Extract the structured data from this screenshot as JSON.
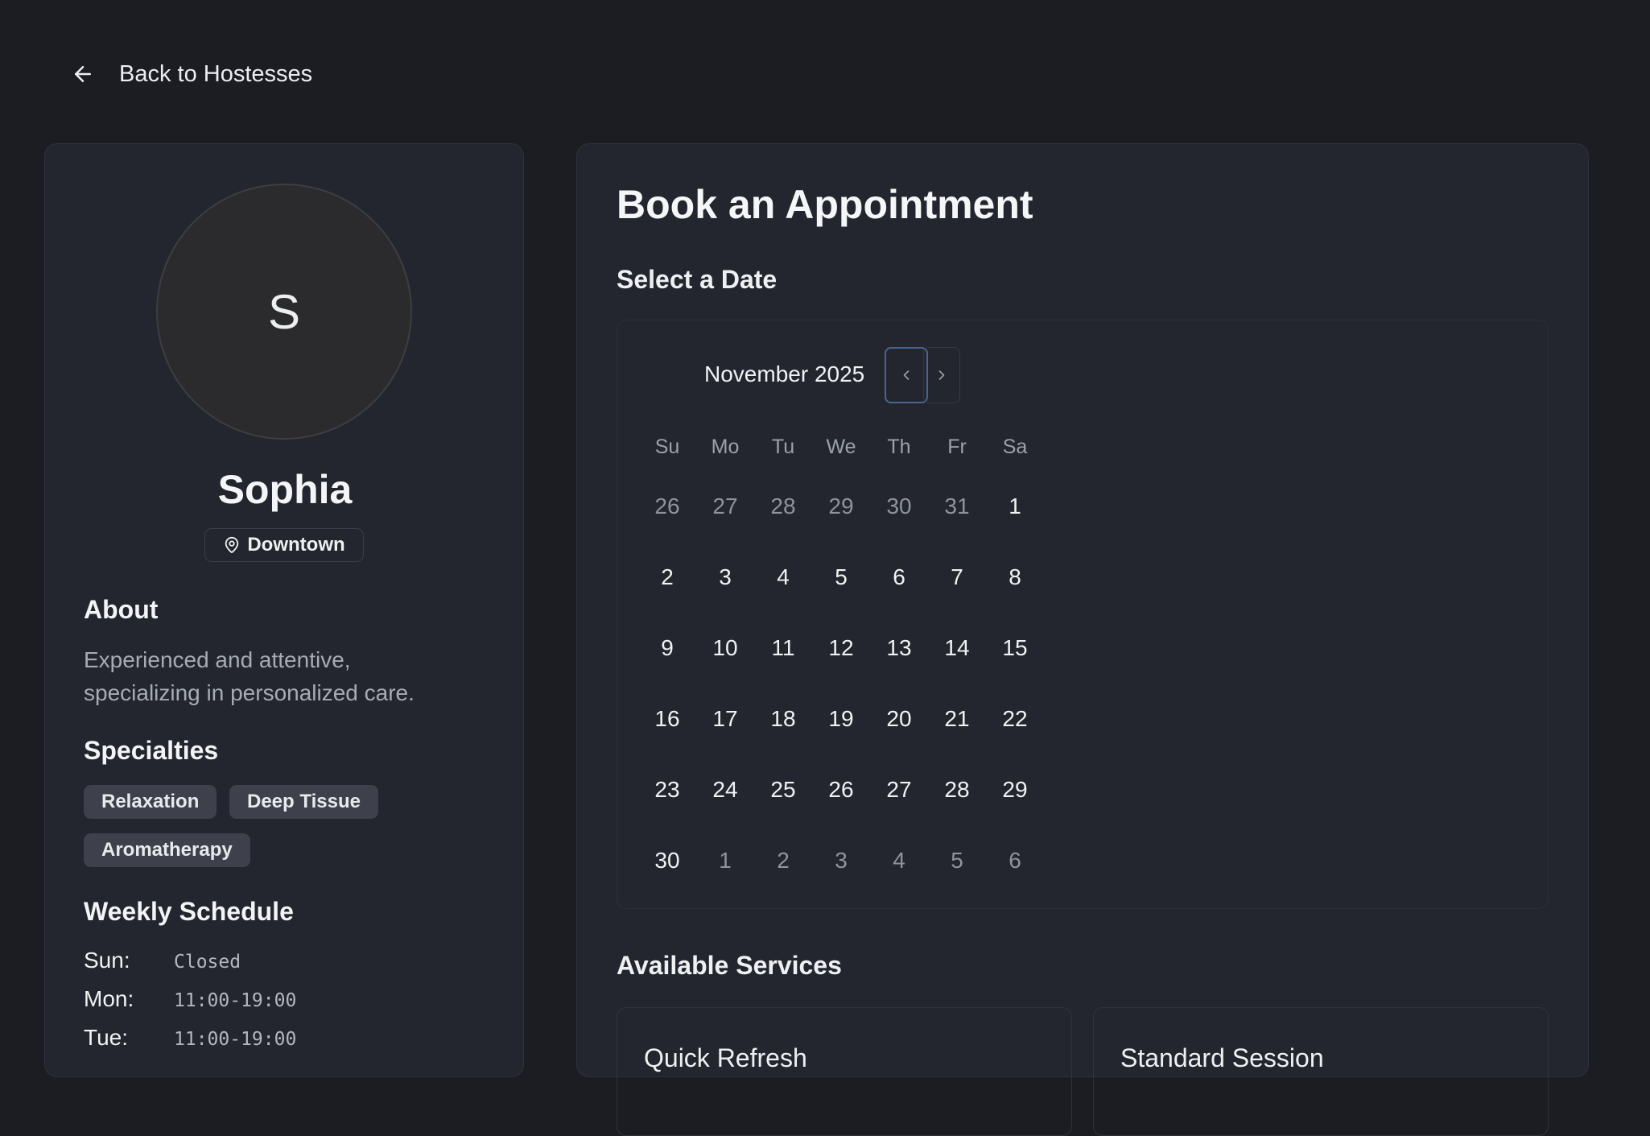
{
  "nav": {
    "back_label": "Back to Hostesses"
  },
  "profile": {
    "initial": "S",
    "name": "Sophia",
    "location": "Downtown",
    "about_heading": "About",
    "about_text": "Experienced and attentive, specializing in personalized care.",
    "specialties_heading": "Specialties",
    "specialties": [
      "Relaxation",
      "Deep Tissue",
      "Aromatherapy"
    ],
    "schedule_heading": "Weekly Schedule",
    "schedule": [
      {
        "day": "Sun:",
        "hours": "Closed"
      },
      {
        "day": "Mon:",
        "hours": "11:00-19:00"
      },
      {
        "day": "Tue:",
        "hours": "11:00-19:00"
      }
    ]
  },
  "booking": {
    "title": "Book an Appointment",
    "select_date_heading": "Select a Date",
    "calendar": {
      "month_label": "November 2025",
      "weekdays": [
        "Su",
        "Mo",
        "Tu",
        "We",
        "Th",
        "Fr",
        "Sa"
      ],
      "weeks": [
        [
          {
            "d": "26",
            "out": true
          },
          {
            "d": "27",
            "out": true
          },
          {
            "d": "28",
            "out": true
          },
          {
            "d": "29",
            "out": true
          },
          {
            "d": "30",
            "out": true
          },
          {
            "d": "31",
            "out": true
          },
          {
            "d": "1",
            "out": false
          }
        ],
        [
          {
            "d": "2",
            "out": false
          },
          {
            "d": "3",
            "out": false
          },
          {
            "d": "4",
            "out": false
          },
          {
            "d": "5",
            "out": false
          },
          {
            "d": "6",
            "out": false
          },
          {
            "d": "7",
            "out": false
          },
          {
            "d": "8",
            "out": false
          }
        ],
        [
          {
            "d": "9",
            "out": false
          },
          {
            "d": "10",
            "out": false
          },
          {
            "d": "11",
            "out": false
          },
          {
            "d": "12",
            "out": false
          },
          {
            "d": "13",
            "out": false
          },
          {
            "d": "14",
            "out": false
          },
          {
            "d": "15",
            "out": false
          }
        ],
        [
          {
            "d": "16",
            "out": false
          },
          {
            "d": "17",
            "out": false
          },
          {
            "d": "18",
            "out": false
          },
          {
            "d": "19",
            "out": false
          },
          {
            "d": "20",
            "out": false
          },
          {
            "d": "21",
            "out": false
          },
          {
            "d": "22",
            "out": false
          }
        ],
        [
          {
            "d": "23",
            "out": false
          },
          {
            "d": "24",
            "out": false
          },
          {
            "d": "25",
            "out": false
          },
          {
            "d": "26",
            "out": false
          },
          {
            "d": "27",
            "out": false
          },
          {
            "d": "28",
            "out": false
          },
          {
            "d": "29",
            "out": false
          }
        ],
        [
          {
            "d": "30",
            "out": false
          },
          {
            "d": "1",
            "out": true
          },
          {
            "d": "2",
            "out": true
          },
          {
            "d": "3",
            "out": true
          },
          {
            "d": "4",
            "out": true
          },
          {
            "d": "5",
            "out": true
          },
          {
            "d": "6",
            "out": true
          }
        ]
      ]
    },
    "services_heading": "Available Services",
    "services": [
      {
        "name": "Quick Refresh"
      },
      {
        "name": "Standard Session"
      }
    ]
  },
  "icons": {
    "back": "arrow-left-icon",
    "location": "map-pin-icon",
    "prev": "chevron-left-icon",
    "next": "chevron-right-icon"
  },
  "colors": {
    "background": "#1c1d22",
    "card": "#23262e",
    "chip": "#3e414b",
    "focus_ring": "#4a6690",
    "muted_text": "#a7abb3"
  }
}
